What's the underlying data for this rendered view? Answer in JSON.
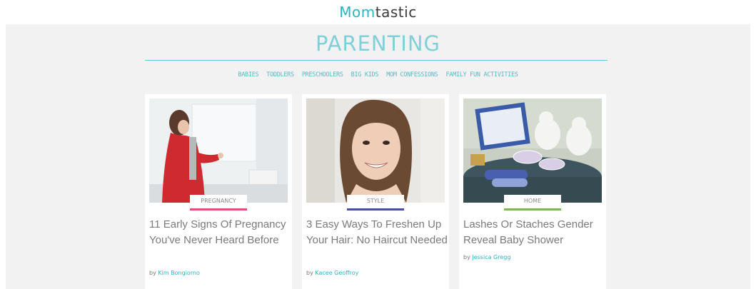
{
  "header": {
    "logo_part1": "Mom",
    "logo_part2": "tastic"
  },
  "section": {
    "title": "PARENTING"
  },
  "subnav": {
    "items": [
      "BABIES",
      "TODDLERS",
      "PRESCHOOLERS",
      "BIG KIDS",
      "MOM CONFESSIONS",
      "FAMILY FUN ACTIVITIES"
    ]
  },
  "cards": [
    {
      "tag": "PREGNANCY",
      "tag_color": "#e0507a",
      "headline": "11 Early Signs Of Pregnancy You've Never Heard Before",
      "by": "by",
      "author": "Kim Bongiorno"
    },
    {
      "tag": "STYLE",
      "tag_color": "#4a4da3",
      "headline": "3 Easy Ways To Freshen Up Your Hair: No Haircut Needed",
      "by": "by",
      "author": "Kacee Geoffroy"
    },
    {
      "tag": "HOME",
      "tag_color": "#7fb85a",
      "headline": "Lashes Or Staches Gender Reveal Baby Shower",
      "by": "by",
      "author": "Jessica Gregg"
    }
  ],
  "colors": {
    "accent": "#27b6c2",
    "band": "#f2f2f2"
  }
}
